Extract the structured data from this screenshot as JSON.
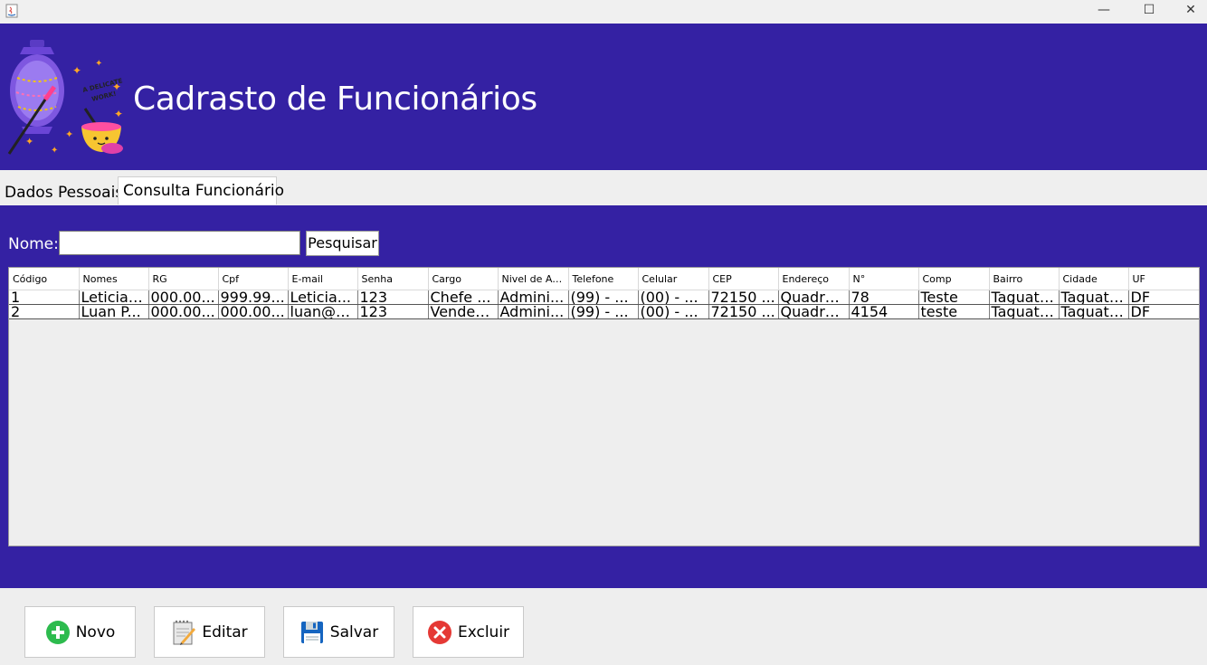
{
  "window": {
    "minimize_glyph": "—",
    "maximize_glyph": "☐",
    "close_glyph": "✕"
  },
  "header": {
    "title": "Cadrasto de Funcionários",
    "logo_text_line1": "A DELICATE",
    "logo_text_line2": "WORK!"
  },
  "tabs": [
    {
      "label": "Dados Pessoais",
      "selected": false
    },
    {
      "label": "Consulta Funcionário",
      "selected": true
    }
  ],
  "search": {
    "label": "Nome:",
    "value": "",
    "button_label": "Pesquisar"
  },
  "table": {
    "columns": [
      "Código",
      "Nomes",
      "RG",
      "Cpf",
      "E-mail",
      "Senha",
      "Cargo",
      "Nivel de Ac...",
      "Telefone",
      "Celular",
      "CEP",
      "Endereço",
      "N°",
      "Comp",
      "Bairro",
      "Cidade",
      "UF"
    ],
    "rows": [
      [
        "1",
        "Leticia ...",
        "000.00...",
        "999.99...",
        "Leticia...",
        "123",
        "Chefe ...",
        "Admini...",
        "(99) - ...",
        "(00) - ...",
        "72150 ...",
        "Quadra...",
        "78",
        "Teste",
        "Taguati...",
        "Taguati...",
        "DF"
      ],
      [
        "2",
        "Luan P...",
        "000.00...",
        "000.00...",
        "luan@g...",
        "123",
        "Vended...",
        "Admini...",
        "(99) - ...",
        "(00) - ...",
        "72150 ...",
        "Quadra...",
        "4154",
        "teste",
        "Taguati...",
        "Taguati...",
        "DF"
      ]
    ]
  },
  "actions": {
    "novo": "Novo",
    "editar": "Editar",
    "salvar": "Salvar",
    "excluir": "Excluir"
  },
  "colors": {
    "primary": "#3421a3",
    "add_green": "#2dbb4e",
    "delete_red": "#e53935",
    "save_blue": "#1565c0"
  },
  "icons": {
    "app": "java-icon",
    "novo": "plus-circle-icon",
    "editar": "notepad-pencil-icon",
    "salvar": "floppy-disk-icon",
    "excluir": "x-circle-icon"
  }
}
